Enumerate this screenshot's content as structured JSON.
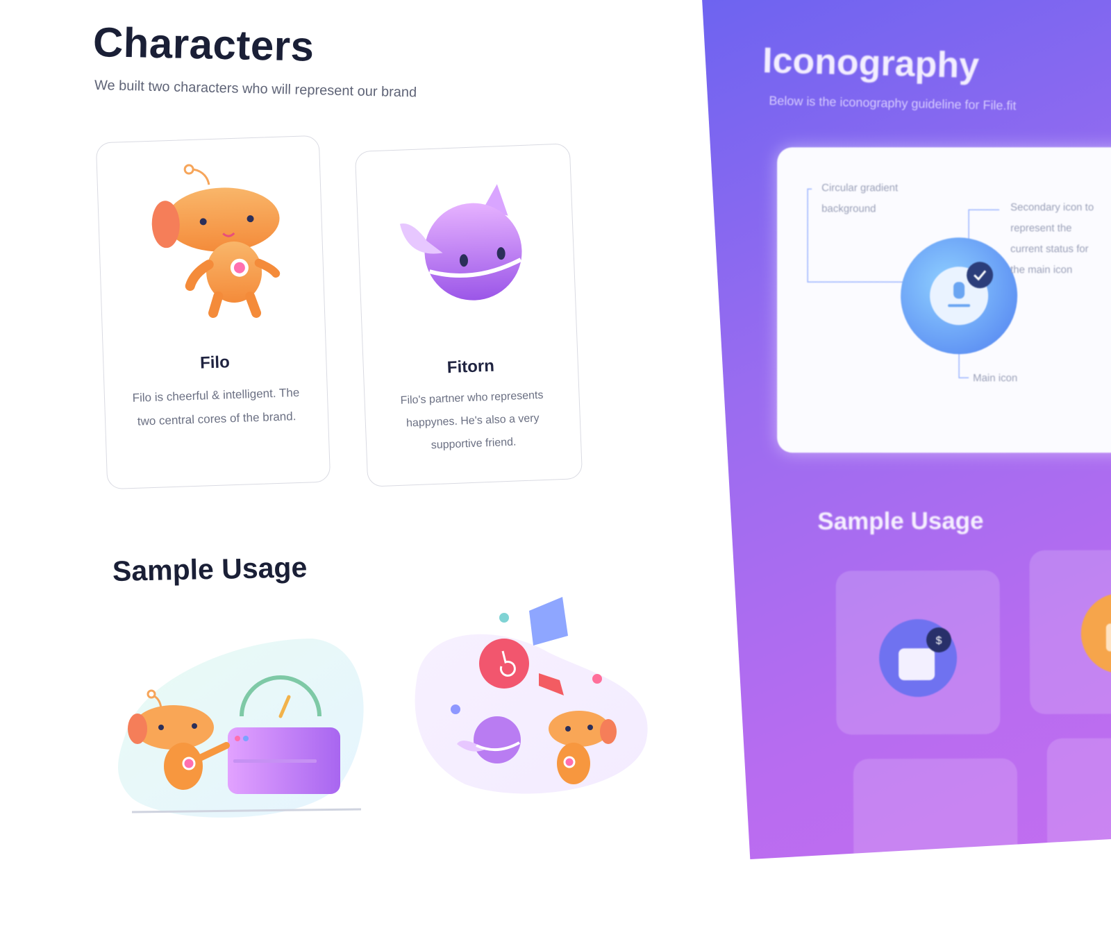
{
  "characters_section": {
    "title": "Characters",
    "subtitle": "We built two characters who will represent our brand",
    "cards": [
      {
        "name": "Filo",
        "description": "Filo is cheerful & intelligent. The two central cores of the brand."
      },
      {
        "name": "Fitorn",
        "description": "Filo's partner who represents happynes. He's also a very supportive friend."
      }
    ]
  },
  "sample_usage_left": {
    "title": "Sample Usage"
  },
  "iconography_section": {
    "title": "Iconography",
    "subtitle": "Below is the iconography guideline for File.fit",
    "diagram": {
      "label_background": [
        "Circular gradient",
        "background"
      ],
      "label_secondary": [
        "Secondary icon to",
        "represent the",
        "current status for",
        "the main icon"
      ],
      "label_main": "Main icon"
    },
    "sample_usage_title": "Sample Usage",
    "tiles": [
      {
        "icon": "calendar-dollar-icon",
        "badge": "$"
      },
      {
        "icon": "window-warning-icon",
        "badge": "!"
      }
    ]
  },
  "colors": {
    "heading": "#1a1f36",
    "panel_start": "#6c63f0",
    "panel_end": "#c36ef0",
    "robot_orange": "#f7a04b",
    "fitorn_purple": "#b77ef2"
  }
}
